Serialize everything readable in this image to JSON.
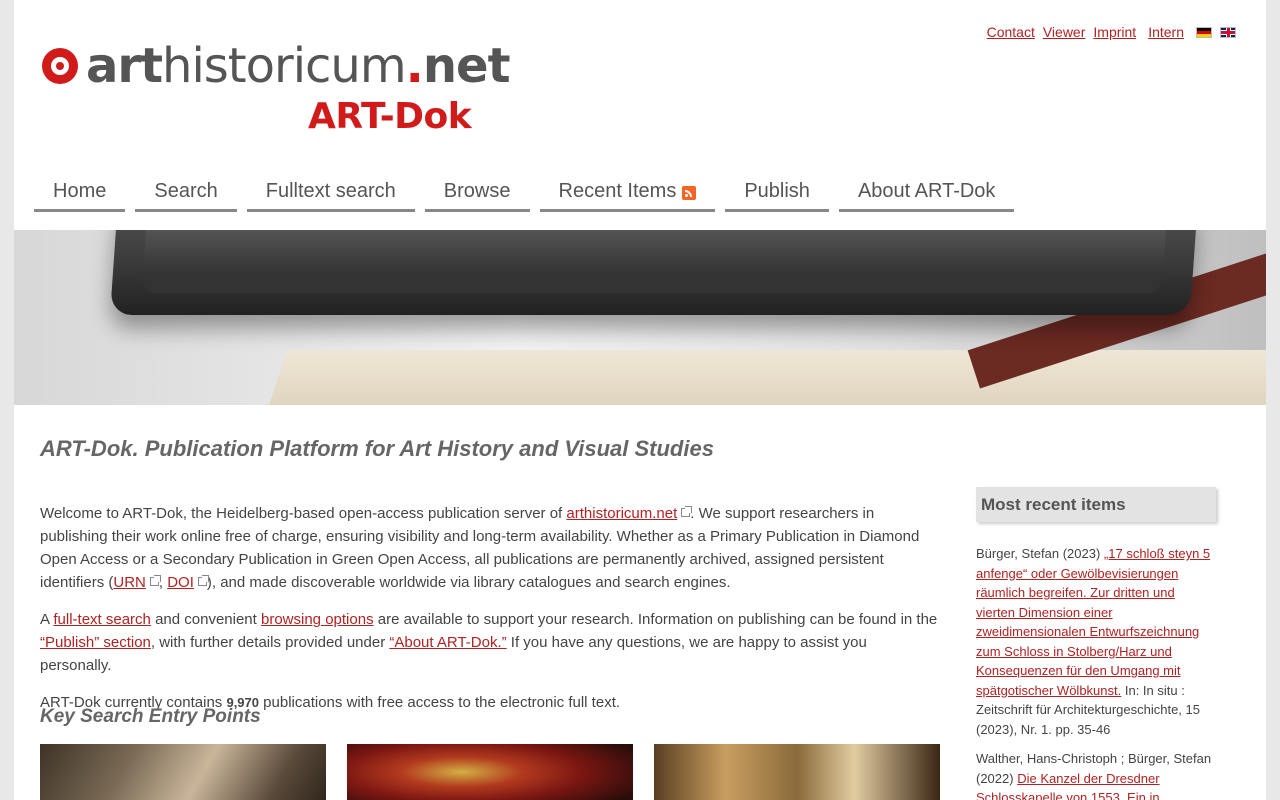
{
  "header": {
    "logo_art": "art",
    "logo_historicum": "historicum",
    "logo_dot": ".",
    "logo_net": "net",
    "logo_sub": "ART-Dok",
    "top_links": [
      "Contact",
      "Viewer",
      "Imprint",
      "Intern"
    ]
  },
  "nav": {
    "items": [
      "Home",
      "Search",
      "Fulltext search",
      "Browse",
      "Recent Items",
      "Publish",
      "About ART-Dok"
    ]
  },
  "main": {
    "title": "ART-Dok. Publication Platform for Art History and Visual Studies",
    "p1_a": "Welcome to ART-Dok, the Heidelberg-based open-access publication server of ",
    "p1_link": "arthistoricum.net",
    "p1_b": ". We support researchers in publishing their work online free of charge, ensuring visibility and long-term availability. Whether as a Primary Publication in Diamond Open Access or a Secondary Publication in Green Open Access, all publications are permanently archived, assigned persistent identifiers (",
    "p1_urn": "URN",
    "p1_sep": ", ",
    "p1_doi": "DOI",
    "p1_c": "), and made discoverable worldwide via library catalogues and search engines.",
    "p2_a": "A ",
    "p2_link1": "full-text search",
    "p2_b": " and convenient ",
    "p2_link2": "browsing options",
    "p2_c": " are available to support your research. Information on publishing can be found in the ",
    "p2_link3": "“Publish” section",
    "p2_d": ", with further details provided under ",
    "p2_link4": "“About ART-Dok.”",
    "p2_e": " If you have any questions, we are happy to assist you personally.",
    "p3_a": "ART-Dok currently contains ",
    "p3_count": "9,970",
    "p3_b": " publications with free access to the electronic full text.",
    "key_title": "Key Search Entry Points"
  },
  "sidebar": {
    "title": "Most recent items",
    "items": [
      {
        "author": "Bürger, Stefan (2023) ",
        "link": "„17 schloß steyn 5 anfenge“ oder Gewölbevisierungen räumlich begreifen. Zur dritten und vierten Dimension einer zweidimensionalen Entwurfszeichnung zum Schloss in Stolberg/Harz und Konsequenzen für den Umgang mit spätgotischer Wölbkunst.",
        "rest": " In: In situ : Zeitschrift für Architekturgeschichte, 15 (2023), Nr. 1. pp. 35-46"
      },
      {
        "author": "Walther, Hans-Christoph ; Bürger, Stefan (2022) ",
        "link": "Die Kanzel der Dresdner Schlosskapelle von 1553. Ein in",
        "rest": ""
      }
    ]
  },
  "colors": {
    "link": "#b22222",
    "brand_red": "#d11b1b",
    "text": "#444444"
  }
}
